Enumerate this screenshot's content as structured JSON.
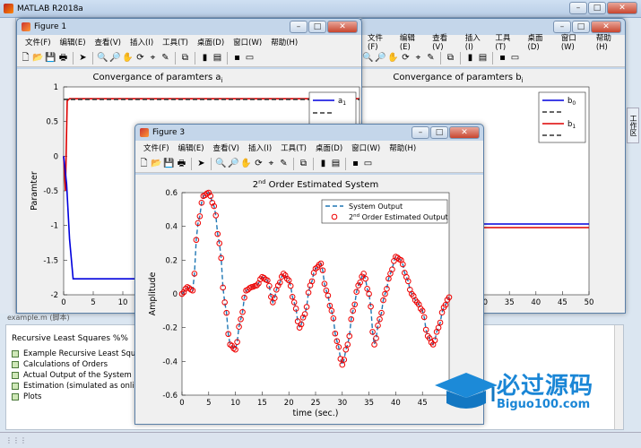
{
  "app": {
    "title": "MATLAB R2018a"
  },
  "side_tab": "工作区",
  "editor": {
    "file_label": "example.m",
    "file_suffix": "(脚本)",
    "heading": "Recursive Least Squares %%",
    "cells": [
      "Example Recursive Least Squares",
      "Calculations of Orders",
      "Actual Output of the System",
      "Estimation (simulated as online)",
      "Plots"
    ]
  },
  "menus": [
    "文件(F)",
    "编辑(E)",
    "查看(V)",
    "插入(I)",
    "工具(T)",
    "桌面(D)",
    "窗口(W)",
    "帮助(H)"
  ],
  "window_buttons": {
    "minimize": "–",
    "maximize": "□",
    "close": "✕"
  },
  "figure1": {
    "title": "Figure 1",
    "chart_data": {
      "type": "line",
      "title": "Convergance of paramters a",
      "title_sub": "i",
      "ylabel": "Paramter",
      "xlim": [
        0,
        50
      ],
      "ylim": [
        -2,
        1
      ],
      "y_ticks": [
        "1",
        "0.5",
        "0",
        "-0.5",
        "-1",
        "-1.5",
        "-2"
      ],
      "x_ticks": [
        "0",
        "5",
        "10"
      ],
      "legend": [
        {
          "name": "a",
          "sub": "1",
          "color": "#0000dd",
          "style": "solid"
        },
        {
          "name": "",
          "sub": "",
          "color": "#333333",
          "style": "dashed"
        },
        {
          "name": "a",
          "sub": "2",
          "color": "#dd0000",
          "style": "solid"
        }
      ],
      "series": [
        {
          "color": "#dd0000",
          "x": [
            0,
            0.3,
            0.6,
            1,
            50
          ],
          "y": [
            0,
            -0.5,
            0.8,
            0.83,
            0.83
          ]
        },
        {
          "color": "#333333",
          "dash": true,
          "x": [
            0,
            50
          ],
          "y": [
            0.82,
            0.82
          ]
        },
        {
          "color": "#0000dd",
          "x": [
            0,
            0.5,
            1,
            1.6,
            50
          ],
          "y": [
            0,
            -0.4,
            -1.2,
            -1.77,
            -1.77
          ]
        }
      ]
    }
  },
  "figure2": {
    "title": "",
    "chart_data": {
      "type": "line",
      "title": "Convergance of paramters b",
      "title_sub": "i",
      "xlim": [
        0,
        50
      ],
      "x_ticks": [
        "30",
        "35",
        "40",
        "45",
        "50"
      ],
      "legend": [
        {
          "name": "b",
          "sub": "0",
          "color": "#0000dd",
          "style": "solid"
        },
        {
          "name": "",
          "sub": "",
          "color": "#333333",
          "style": "dashed"
        },
        {
          "name": "b",
          "sub": "1",
          "color": "#dd0000",
          "style": "solid"
        },
        {
          "name": "",
          "sub": "",
          "color": "#333333",
          "style": "dashed"
        }
      ]
    }
  },
  "figure3": {
    "title": "Figure 3",
    "chart_data": {
      "type": "line",
      "title_pre": "2",
      "title_sup": "nd",
      "title_post": " Order Estimated System",
      "xlabel": "time (sec.)",
      "ylabel": "Amplitude",
      "xlim": [
        0,
        50
      ],
      "ylim": [
        -0.6,
        0.6
      ],
      "x_ticks": [
        "0",
        "5",
        "10",
        "15",
        "20",
        "25",
        "30",
        "35",
        "40",
        "45"
      ],
      "y_ticks": [
        "0.6",
        "0.4",
        "0.2",
        "0",
        "-0.2",
        "-0.4",
        "-0.6"
      ],
      "legend": [
        {
          "name": "System Output",
          "color": "#1f77b4",
          "style": "dashed"
        },
        {
          "pre": "2",
          "sup": "nd",
          "post": " Order Estimated Output",
          "color": "#ee0000",
          "style": "circle"
        }
      ],
      "keypoints": [
        [
          0,
          0
        ],
        [
          1,
          0.04
        ],
        [
          2,
          0.02
        ],
        [
          3,
          0.42
        ],
        [
          4,
          0.58
        ],
        [
          5,
          0.6
        ],
        [
          6,
          0.52
        ],
        [
          7,
          0.3
        ],
        [
          8,
          -0.05
        ],
        [
          9,
          -0.3
        ],
        [
          10,
          -0.33
        ],
        [
          11,
          -0.15
        ],
        [
          12,
          0.02
        ],
        [
          13,
          0.04
        ],
        [
          14,
          0.05
        ],
        [
          15,
          0.1
        ],
        [
          16,
          0.08
        ],
        [
          17,
          -0.05
        ],
        [
          18,
          0.05
        ],
        [
          19,
          0.12
        ],
        [
          20,
          0.08
        ],
        [
          21,
          -0.05
        ],
        [
          22,
          -0.2
        ],
        [
          23,
          -0.12
        ],
        [
          24,
          0.05
        ],
        [
          25,
          0.15
        ],
        [
          26,
          0.18
        ],
        [
          27,
          0.02
        ],
        [
          28,
          -0.1
        ],
        [
          29,
          -0.28
        ],
        [
          30,
          -0.42
        ],
        [
          31,
          -0.3
        ],
        [
          32,
          -0.1
        ],
        [
          33,
          0.05
        ],
        [
          34,
          0.12
        ],
        [
          35,
          0.0
        ],
        [
          36,
          -0.3
        ],
        [
          37,
          -0.15
        ],
        [
          38,
          0.0
        ],
        [
          39,
          0.12
        ],
        [
          40,
          0.22
        ],
        [
          41,
          0.2
        ],
        [
          42,
          0.1
        ],
        [
          43,
          0.0
        ],
        [
          44,
          -0.05
        ],
        [
          45,
          -0.1
        ],
        [
          46,
          -0.25
        ],
        [
          47,
          -0.3
        ],
        [
          48,
          -0.2
        ],
        [
          49,
          -0.08
        ],
        [
          50,
          -0.02
        ]
      ]
    }
  },
  "watermark": {
    "brand": "必过源码",
    "url": "Biguo100.com"
  }
}
